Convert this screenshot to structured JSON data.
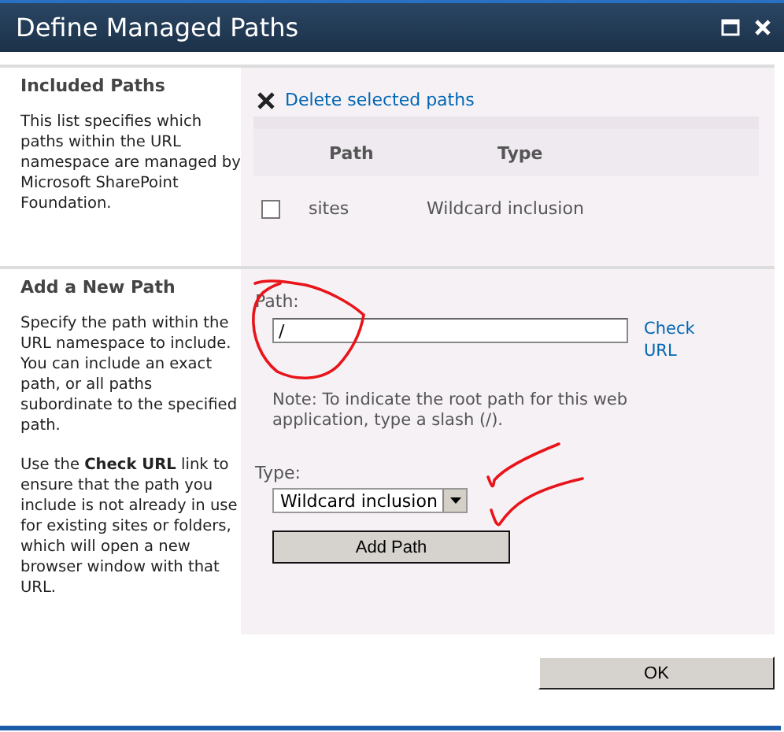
{
  "window": {
    "title": "Define Managed Paths"
  },
  "included_paths": {
    "heading": "Included Paths",
    "description": "This list specifies which paths within the URL namespace are managed by Microsoft SharePoint Foundation.",
    "delete_link": "Delete selected paths",
    "columns": [
      "Path",
      "Type"
    ],
    "rows": [
      {
        "checked": false,
        "path": "sites",
        "type": "Wildcard inclusion"
      }
    ]
  },
  "add_path": {
    "heading": "Add a New Path",
    "descriptions": [
      "Specify the path within the URL namespace to include. You can include an exact path, or all paths subordinate to the specified path.",
      "Use the **Check URL** link to ensure that the path you include is not already in use for existing sites or folders, which will open a new browser window with that URL."
    ],
    "path_label": "Path:",
    "path_value": "/",
    "check_link": "Check URL",
    "note": "Note: To indicate the root path for this web application, type a slash (/).",
    "type_label": "Type:",
    "type_value": "Wildcard inclusion",
    "add_button": "Add Path"
  },
  "buttons": [
    "OK"
  ]
}
